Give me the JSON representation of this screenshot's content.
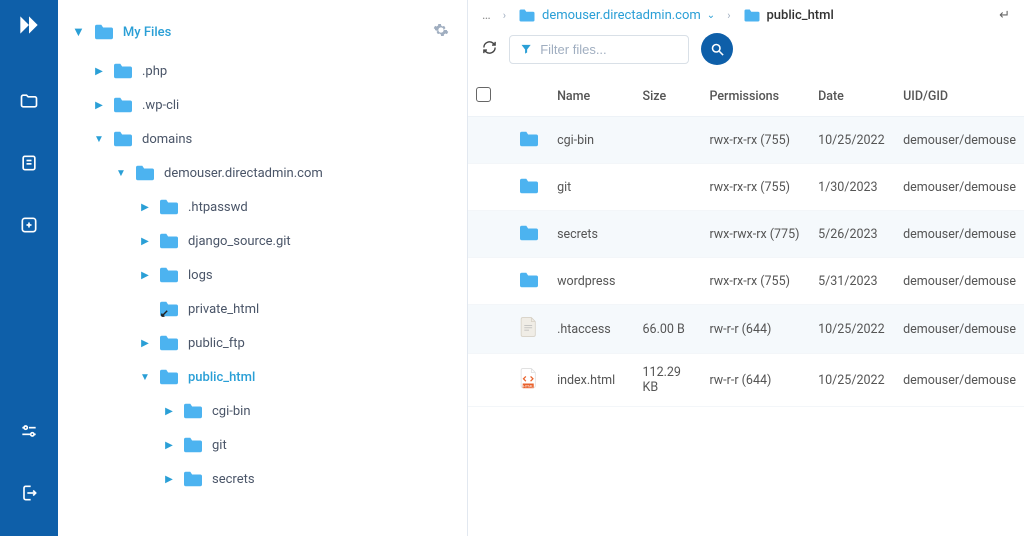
{
  "rail": {
    "icons": [
      "logo",
      "folder",
      "document",
      "add",
      "settings",
      "logout"
    ]
  },
  "tree": {
    "root_label": "My Files",
    "items": [
      {
        "label": ".php",
        "indent": 1,
        "caret": "right",
        "active": false
      },
      {
        "label": ".wp-cli",
        "indent": 1,
        "caret": "right",
        "active": false
      },
      {
        "label": "domains",
        "indent": 1,
        "caret": "down",
        "active": false
      },
      {
        "label": "demouser.directadmin.com",
        "indent": 2,
        "caret": "down",
        "active": false
      },
      {
        "label": ".htpasswd",
        "indent": 3,
        "caret": "right",
        "active": false
      },
      {
        "label": "django_source.git",
        "indent": 3,
        "caret": "right",
        "active": false
      },
      {
        "label": "logs",
        "indent": 3,
        "caret": "right",
        "active": false
      },
      {
        "label": "private_html",
        "indent": 3,
        "caret": "none",
        "active": false,
        "symlink": true
      },
      {
        "label": "public_ftp",
        "indent": 3,
        "caret": "right",
        "active": false
      },
      {
        "label": "public_html",
        "indent": 3,
        "caret": "down",
        "active": true
      },
      {
        "label": "cgi-bin",
        "indent": 4,
        "caret": "right",
        "active": false
      },
      {
        "label": "git",
        "indent": 4,
        "caret": "right",
        "active": false
      },
      {
        "label": "secrets",
        "indent": 4,
        "caret": "right",
        "active": false
      }
    ]
  },
  "breadcrumb": {
    "dots": "…",
    "domain": "demouser.directadmin.com",
    "current": "public_html",
    "return_icon": "↵"
  },
  "search": {
    "placeholder": "Filter files..."
  },
  "table": {
    "headers": {
      "name": "Name",
      "size": "Size",
      "permissions": "Permissions",
      "date": "Date",
      "uidgid": "UID/GID"
    },
    "rows": [
      {
        "type": "folder",
        "name": "cgi-bin",
        "size": "",
        "perm": "rwx-rx-rx (755)",
        "date": "10/25/2022",
        "uid": "demouser/demouse"
      },
      {
        "type": "folder",
        "name": "git",
        "size": "",
        "perm": "rwx-rx-rx (755)",
        "date": "1/30/2023",
        "uid": "demouser/demouse"
      },
      {
        "type": "folder",
        "name": "secrets",
        "size": "",
        "perm": "rwx-rwx-rx (775)",
        "date": "5/26/2023",
        "uid": "demouser/demouse"
      },
      {
        "type": "folder",
        "name": "wordpress",
        "size": "",
        "perm": "rwx-rx-rx (755)",
        "date": "5/31/2023",
        "uid": "demouser/demouse"
      },
      {
        "type": "file-txt",
        "name": ".htaccess",
        "size": "66.00 B",
        "perm": "rw-r-r (644)",
        "date": "10/25/2022",
        "uid": "demouser/demouse"
      },
      {
        "type": "file-html",
        "name": "index.html",
        "size": "112.29 KB",
        "perm": "rw-r-r (644)",
        "date": "10/25/2022",
        "uid": "demouser/demouse"
      }
    ]
  }
}
